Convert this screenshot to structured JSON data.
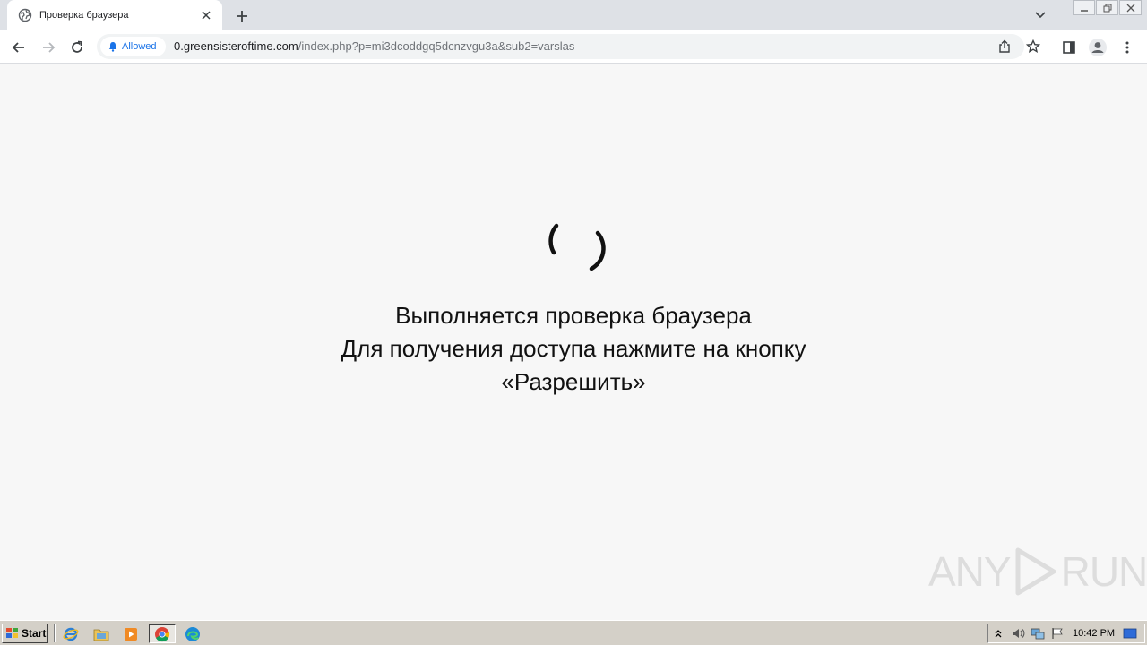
{
  "browser": {
    "tab": {
      "title": "Проверка браузера"
    },
    "permission_chip": {
      "label": "Allowed"
    },
    "address": {
      "domain": "0.greensisteroftime.com",
      "path": "/index.php?p=mi3dcoddgq5dcnzvgu3a&sub2=varslas"
    }
  },
  "page": {
    "lines": [
      "Выполняется проверка браузера",
      "Для получения доступа нажмите на кнопку",
      "«Разрешить»"
    ]
  },
  "watermark": {
    "left": "ANY",
    "right": "RUN"
  },
  "taskbar": {
    "start_label": "Start",
    "clock": "10:42 PM"
  },
  "colors": {
    "accent": "#1a73e8",
    "page_bg": "#f7f7f7",
    "tabstrip_bg": "#dee1e6",
    "taskbar_bg": "#d4d0c8"
  }
}
